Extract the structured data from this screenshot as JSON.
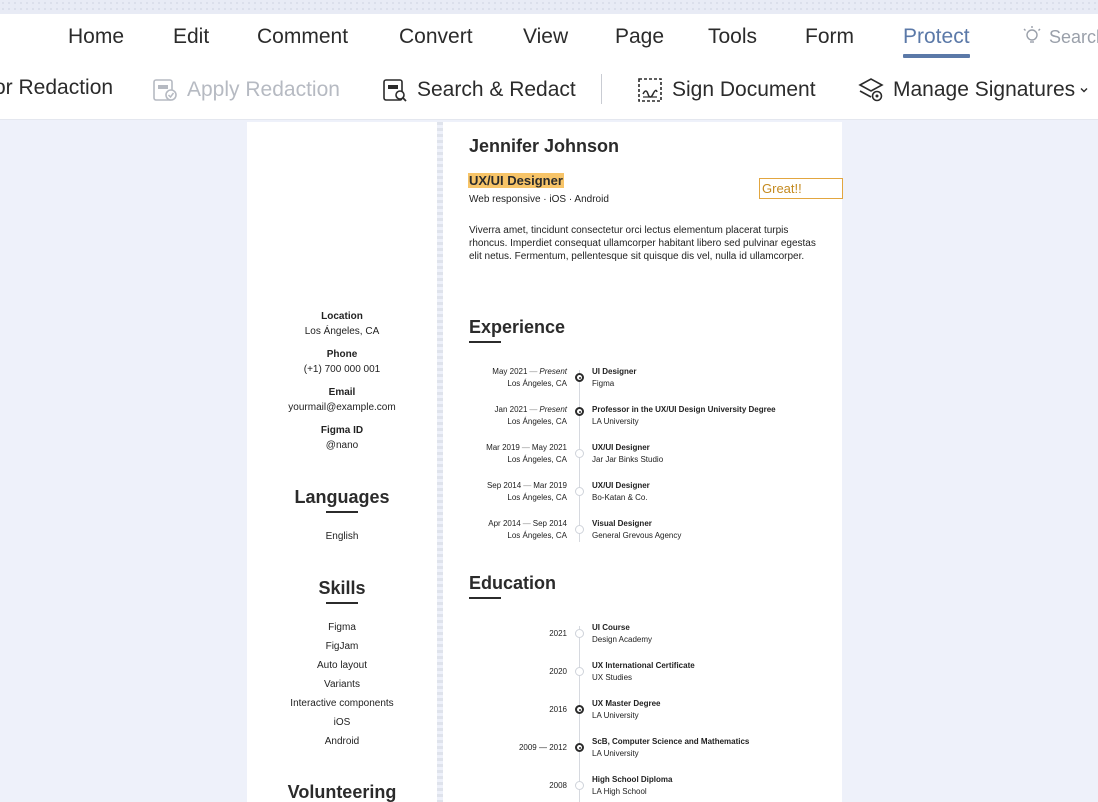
{
  "menu": {
    "items": [
      "Home",
      "Edit",
      "Comment",
      "Convert",
      "View",
      "Page",
      "Tools",
      "Form",
      "Protect"
    ],
    "active": "Protect",
    "search_label": "Search"
  },
  "toolbar": {
    "mark_redaction": "or Redaction",
    "apply_redaction": "Apply Redaction",
    "search_redact": "Search & Redact",
    "sign_document": "Sign Document",
    "manage_signatures": "Manage Signatures"
  },
  "resume": {
    "name": "Jennifer Johnson",
    "role": "UX/UI Designer",
    "platforms": "Web responsive · iOS · Android",
    "annotation": "Great!!",
    "bio": "Viverra amet, tincidunt consectetur orci lectus elementum placerat turpis rhoncus. Imperdiet consequat ullamcorper habitant libero sed pulvinar egestas elit netus. Fermentum, pellentesque sit quisque dis vel, nulla id ullamcorper.",
    "contact": {
      "location_label": "Location",
      "location": "Los Ángeles, CA",
      "phone_label": "Phone",
      "phone": "(+1) 700 000 001",
      "email_label": "Email",
      "email": "yourmail@example.com",
      "figma_label": "Figma ID",
      "figma": "@nano"
    },
    "languages_heading": "Languages",
    "languages": [
      "English"
    ],
    "skills_heading": "Skills",
    "skills": [
      "Figma",
      "FigJam",
      "Auto layout",
      "Variants",
      "Interactive components",
      "iOS",
      "Android"
    ],
    "volunteering_heading": "Volunteering",
    "experience_heading": "Experience",
    "experience": [
      {
        "start": "May 2021",
        "end": "Present",
        "end_italic": true,
        "location": "Los Ángeles, CA",
        "title": "UI Designer",
        "org": "Figma",
        "current": true
      },
      {
        "start": "Jan 2021",
        "end": "Present",
        "end_italic": true,
        "location": "Los Ángeles, CA",
        "title": "Professor in the UX/UI Design University Degree",
        "org": "LA University",
        "current": true
      },
      {
        "start": "Mar 2019",
        "end": "May 2021",
        "end_italic": false,
        "location": "Los Ángeles, CA",
        "title": "UX/UI Designer",
        "org": "Jar Jar Binks Studio",
        "current": false
      },
      {
        "start": "Sep 2014",
        "end": "Mar 2019",
        "end_italic": false,
        "location": "Los Ángeles, CA",
        "title": "UX/UI Designer",
        "org": "Bo-Katan & Co.",
        "current": false
      },
      {
        "start": "Apr 2014",
        "end": "Sep 2014",
        "end_italic": false,
        "location": "Los Ángeles, CA",
        "title": "Visual Designer",
        "org": "General Grevous Agency",
        "current": false
      }
    ],
    "education_heading": "Education",
    "education": [
      {
        "date": "2021",
        "title": "UI Course",
        "org": "Design Academy",
        "highlight": false
      },
      {
        "date": "2020",
        "title": "UX International Certificate",
        "org": "UX Studies",
        "highlight": false
      },
      {
        "date": "2016",
        "title": "UX Master Degree",
        "org": "LA University",
        "highlight": true
      },
      {
        "date": "2009 — 2012",
        "title": "ScB, Computer Science and Mathematics",
        "org": "LA University",
        "highlight": true
      },
      {
        "date": "2008",
        "title": "High School Diploma",
        "org": "LA High School",
        "highlight": false
      }
    ]
  },
  "colors": {
    "accent": "#5b79a8",
    "highlight": "#f7c468",
    "annotation_border": "#e2a640"
  }
}
